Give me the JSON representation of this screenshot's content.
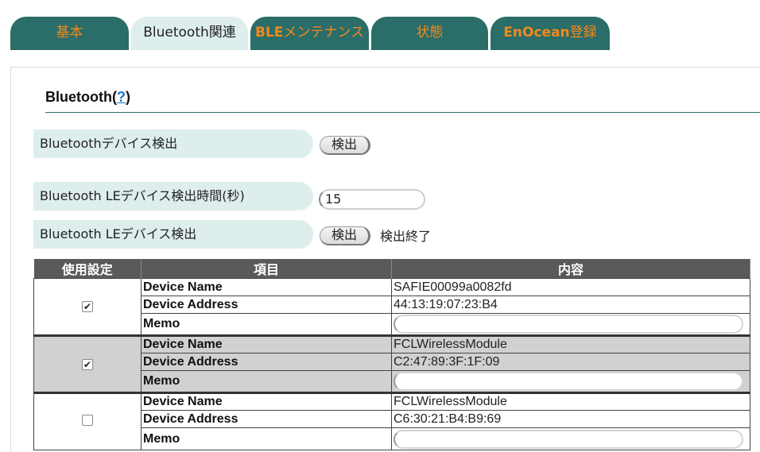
{
  "tabs": [
    {
      "label": "基本",
      "active": false
    },
    {
      "label": "Bluetooth関連",
      "active": true
    },
    {
      "label_bold": "BLE",
      "label_rest": "メンテナンス",
      "active": false
    },
    {
      "label": "状態",
      "active": false
    },
    {
      "label_bold": "EnOcean",
      "label_rest": "登録",
      "active": false
    }
  ],
  "section": {
    "title": "Bluetooth(",
    "help": "?",
    "title_end": ")"
  },
  "bt_detect": {
    "label": "Bluetoothデバイス検出",
    "button": "検出"
  },
  "ble_time": {
    "label": "Bluetooth LEデバイス検出時間(秒)",
    "value": "15"
  },
  "ble_detect": {
    "label": "Bluetooth LEデバイス検出",
    "button": "検出",
    "status": "検出終了"
  },
  "table": {
    "headers": [
      "使用設定",
      "項目",
      "内容"
    ],
    "key_labels": {
      "name": "Device Name",
      "address": "Device Address",
      "memo": "Memo"
    },
    "rows": [
      {
        "checked": true,
        "check_glyph": "✔",
        "device_name": "SAFIE00099a0082fd",
        "device_address": "44:13:19:07:23:B4",
        "memo": ""
      },
      {
        "checked": true,
        "check_glyph": "✔",
        "device_name": "FCLWirelessModule",
        "device_address": "C2:47:89:3F:1F:09",
        "memo": ""
      },
      {
        "checked": false,
        "check_glyph": "",
        "device_name": "FCLWirelessModule",
        "device_address": "C6:30:21:B4:B9:69",
        "memo": ""
      }
    ]
  },
  "colors": {
    "tab_bg": "#2b6d68",
    "tab_text": "#f08a1c",
    "tab_active_bg": "#deeeed",
    "label_bg": "#deeeed",
    "table_header_bg": "#5a5a5a",
    "shaded_row_bg": "#d1d1d1",
    "help_link": "#1a77c9"
  }
}
